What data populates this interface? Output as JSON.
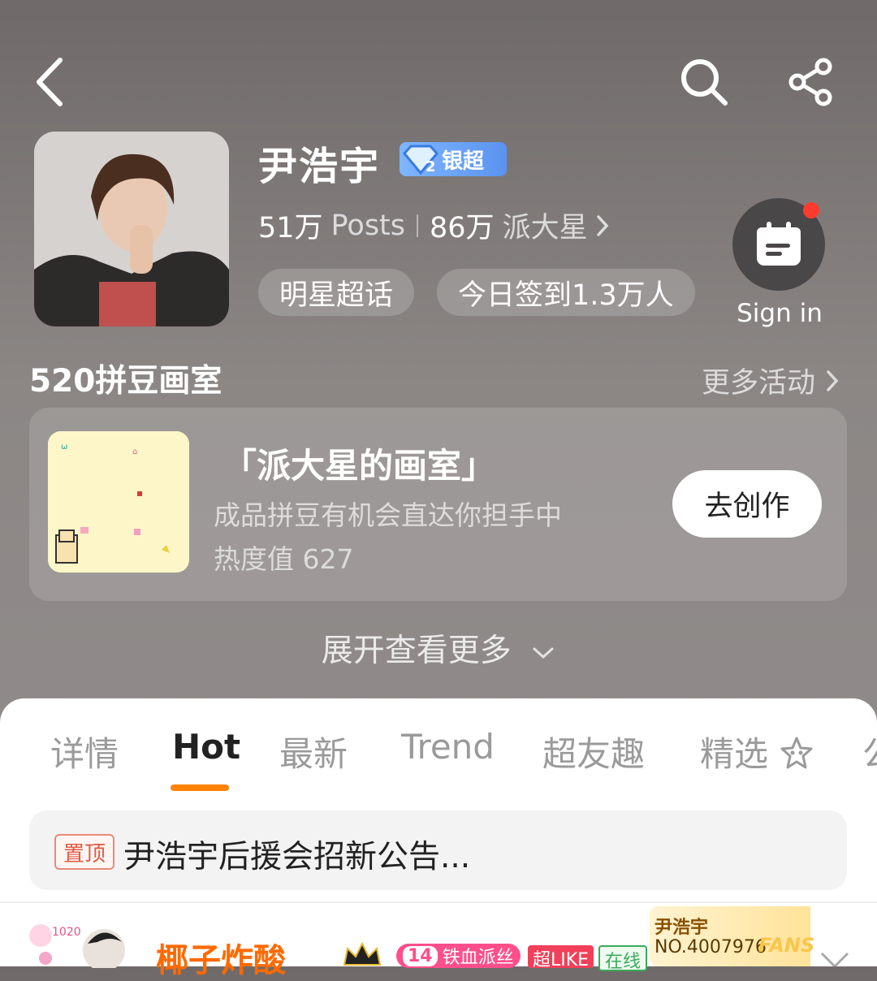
{
  "header": {
    "back_icon": "chevron-left-icon",
    "search_icon": "search-icon",
    "share_icon": "share-icon"
  },
  "profile": {
    "name": "尹浩宇",
    "badge_label": "银超",
    "posts_count": "51万",
    "posts_label": "Posts",
    "fans_count": "86万",
    "fans_label": "派大星",
    "tag_topic": "明星超话",
    "tag_checkin": "今日签到1.3万人",
    "signin_label": "Sign in"
  },
  "activity": {
    "section_title": "520拼豆画室",
    "more_label": "更多活动",
    "card_title": "「派大星的画室」",
    "card_subtitle": "成品拼豆有机会直达你担手中",
    "card_heat": "热度值 627",
    "create_button": "去创作",
    "expand_label": "展开查看更多"
  },
  "tabs": [
    {
      "label": "详情",
      "active": false
    },
    {
      "label": "Hot",
      "active": true
    },
    {
      "label": "最新",
      "active": false
    },
    {
      "label": "Trend",
      "active": false
    },
    {
      "label": "超友趣",
      "active": false
    },
    {
      "label": "精选",
      "active": false
    },
    {
      "label": "公",
      "active": false
    }
  ],
  "pinned": {
    "tag": "置顶",
    "text": "尹浩宇后援会招新公告..."
  },
  "post": {
    "user": "椰子炸酸",
    "medal_level": "14",
    "medal_name": "铁血派丝",
    "medal_like": "超LIKE",
    "medal_online": "在线",
    "fans_card_name": "尹浩宇",
    "fans_card_no": "NO.4007976",
    "fans_card_word": "FANS"
  },
  "colors": {
    "accent_orange": "#ff8200",
    "badge_blue": "#5a93f0",
    "notify_red": "#ff3b30"
  }
}
